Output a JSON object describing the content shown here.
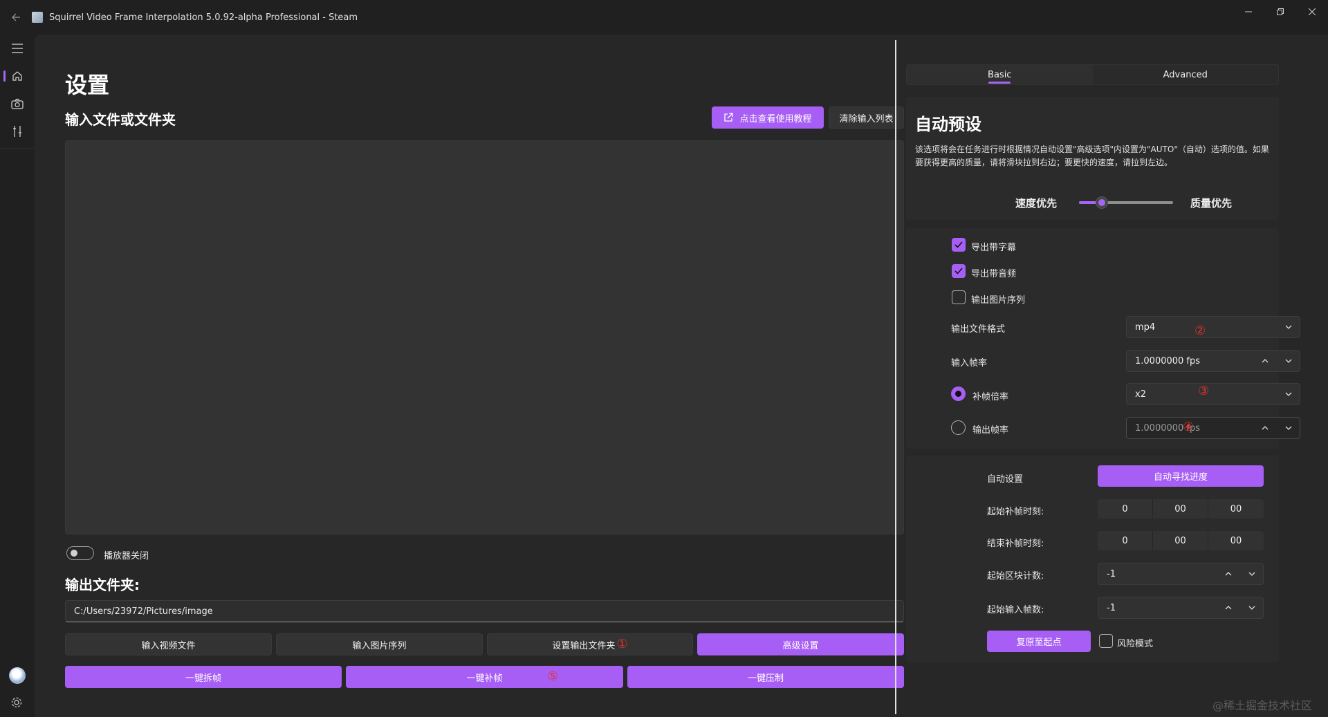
{
  "window": {
    "title": "Squirrel Video Frame Interpolation 5.0.92-alpha  Professional - Steam"
  },
  "nav": {
    "items": [
      "home-icon",
      "camera-icon",
      "tools-icon"
    ],
    "bottom": [
      "avatar",
      "settings-icon"
    ]
  },
  "main": {
    "page_title": "设置",
    "input_section_title": "输入文件或文件夹",
    "tutorial_button": "点击查看使用教程",
    "clear_button": "清除输入列表",
    "player_toggle_label": "播放器关闭",
    "player_toggle_on": false,
    "output_section_title": "输出文件夹:",
    "output_path": "C:/Users/23972/Pictures/image",
    "buttons_row1": [
      "输入视频文件",
      "输入图片序列",
      "设置输出文件夹",
      "高级设置"
    ],
    "marker_output_folder": "①",
    "buttons_row2": [
      "一键拆帧",
      "一键补帧",
      "一键压制"
    ],
    "marker_interpolate": "⑤"
  },
  "right": {
    "tabs": [
      "Basic",
      "Advanced"
    ],
    "selected_tab": "Basic",
    "auto_preset": {
      "title": "自动预设",
      "description": "该选项将会在任务进行时根据情况自动设置\"高级选项\"内设置为\"AUTO\"（自动）选项的值。如果要获得更高的质量，请将滑块拉到右边；要更快的速度，请拉到左边。",
      "speed_label": "速度优先",
      "quality_label": "质量优先",
      "slider_value": 0.2
    },
    "options": {
      "export_subtitles": {
        "label": "导出带字幕",
        "checked": true
      },
      "export_audio": {
        "label": "导出带音频",
        "checked": true
      },
      "export_image_seq": {
        "label": "输出图片序列",
        "checked": false
      },
      "format_label": "输出文件格式",
      "format_value": "mp4",
      "format_marker": "②",
      "input_fps_label": "输入帧率",
      "input_fps_value": "1.0000000 fps",
      "multiplier_label": "补帧倍率",
      "multiplier_value": "x2",
      "multiplier_marker": "③",
      "multiplier_selected": true,
      "output_fps_label": "输出帧率",
      "output_fps_value": "1.0000000 fps",
      "output_fps_marker": "④"
    },
    "auto_settings": {
      "label": "自动设置",
      "find_progress_button": "自动寻找进度",
      "start_time_label": "起始补帧时刻:",
      "start_time": [
        "0",
        "00",
        "00"
      ],
      "end_time_label": "结束补帧时刻:",
      "end_time": [
        "0",
        "00",
        "00"
      ],
      "start_chunk_label": "起始区块计数:",
      "start_chunk_value": "-1",
      "start_frame_label": "起始输入帧数:",
      "start_frame_value": "-1",
      "reset_button": "复原至起点",
      "risk_mode_label": "风险模式",
      "risk_mode_checked": false
    }
  },
  "watermark": "@稀土掘金技术社区"
}
